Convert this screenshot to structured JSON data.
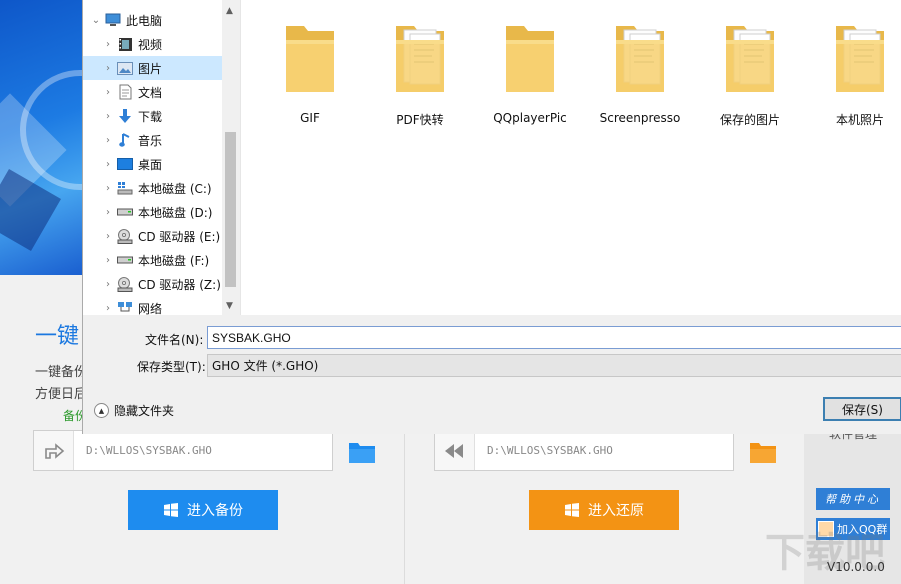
{
  "app": {
    "title_partial": "一键",
    "description_line1": "一键备份",
    "description_line2": "方便日后",
    "backup_link_partial": "备份",
    "backup_path": "D:\\WLLOS\\SYSBAK.GHO",
    "restore_path": "D:\\WLLOS\\SYSBAK.GHO",
    "enter_backup_label": "进入备份",
    "enter_restore_label": "进入还原",
    "tool_label_partial": "软件管理",
    "help_label": "帮助中心",
    "qq_label": "加入QQ群",
    "version": "V10.0.0.0",
    "watermark": "下载吧",
    "colors": {
      "backup_blue": "#1e8cef",
      "restore_orange": "#f39314",
      "title_blue": "#1b78e0"
    }
  },
  "dialog": {
    "nav": [
      {
        "label": "此电脑",
        "icon": "computer-icon",
        "expanded": true
      },
      {
        "label": "视频",
        "icon": "video-icon"
      },
      {
        "label": "图片",
        "icon": "picture-icon",
        "selected": true
      },
      {
        "label": "文档",
        "icon": "document-icon"
      },
      {
        "label": "下载",
        "icon": "download-icon"
      },
      {
        "label": "音乐",
        "icon": "music-icon"
      },
      {
        "label": "桌面",
        "icon": "desktop-icon"
      },
      {
        "label": "本地磁盘 (C:)",
        "icon": "windows-drive-icon"
      },
      {
        "label": "本地磁盘 (D:)",
        "icon": "drive-icon"
      },
      {
        "label": "CD 驱动器 (E:)",
        "icon": "cd-drive-icon"
      },
      {
        "label": "本地磁盘 (F:)",
        "icon": "drive-icon"
      },
      {
        "label": "CD 驱动器 (Z:)",
        "icon": "cd-drive-icon"
      },
      {
        "label": "网络",
        "icon": "network-icon"
      }
    ],
    "files": [
      {
        "name": "GIF",
        "icon": "folder-icon"
      },
      {
        "name": "PDF快转",
        "icon": "folder-docs-icon"
      },
      {
        "name": "QQplayerPic",
        "icon": "folder-icon"
      },
      {
        "name": "Screenpresso",
        "icon": "folder-docs-icon"
      },
      {
        "name": "保存的图片",
        "icon": "folder-docs-icon"
      },
      {
        "name": "本机照片",
        "icon": "folder-docs-icon"
      }
    ],
    "filename_label": "文件名(N):",
    "filename_value": "SYSBAK.GHO",
    "filetype_label": "保存类型(T):",
    "filetype_value": "GHO 文件 (*.GHO)",
    "hide_folders_label": "隐藏文件夹",
    "save_label": "保存(S)"
  }
}
